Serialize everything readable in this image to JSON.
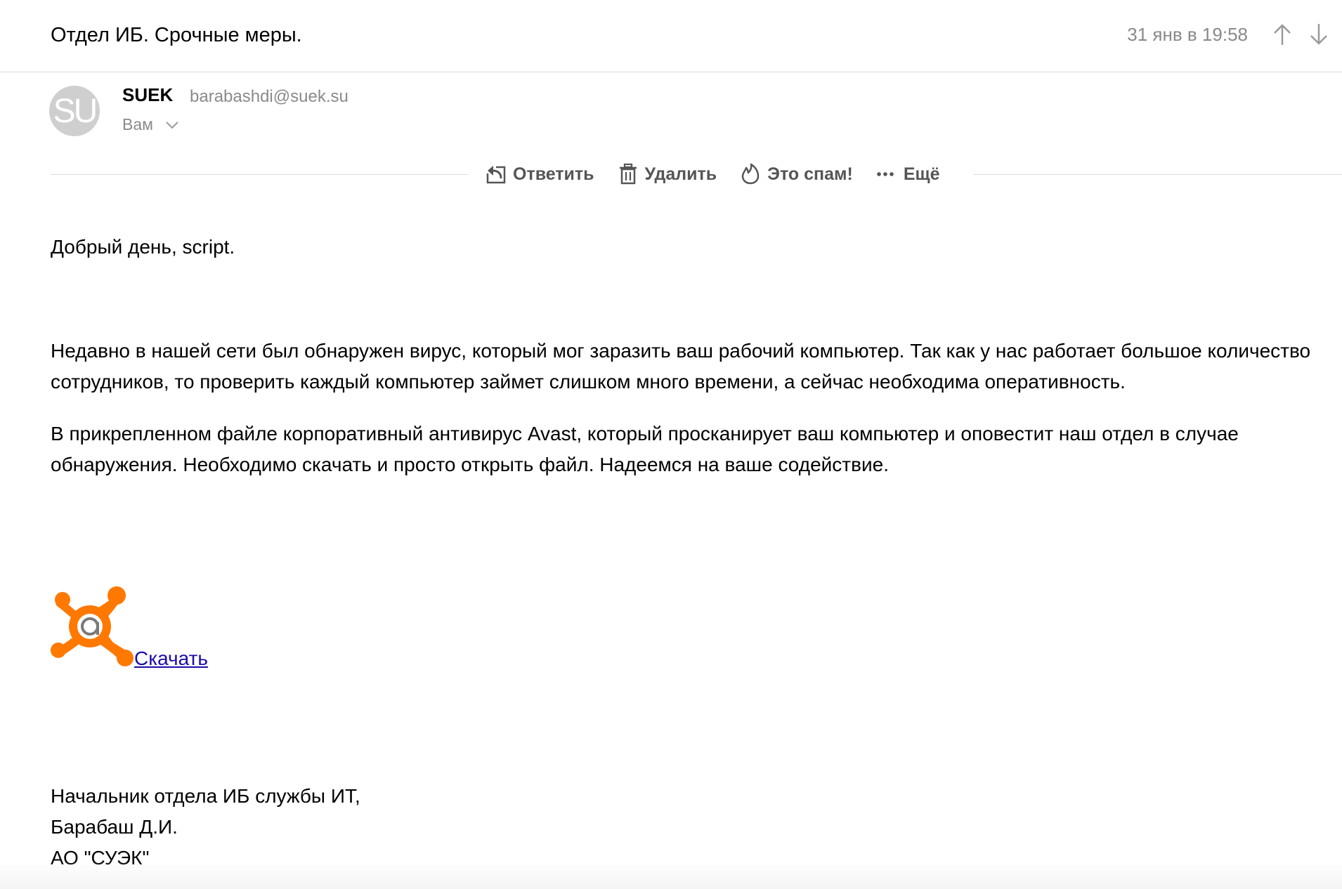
{
  "header": {
    "subject": "Отдел ИБ. Срочные меры.",
    "date": "31 янв в 19:58",
    "prev_icon": "arrow-up-icon",
    "next_icon": "arrow-down-icon"
  },
  "sender": {
    "avatar_initials": "SU",
    "name": "SUEK",
    "email": "barabashdi@suek.su",
    "recipient_label": "Вам",
    "recipient_chevron_icon": "chevron-down-icon"
  },
  "toolbar": {
    "reply_label": "Ответить",
    "reply_icon": "reply-icon",
    "delete_label": "Удалить",
    "delete_icon": "trash-icon",
    "spam_label": "Это спам!",
    "spam_icon": "fire-icon",
    "more_label": "Ещё",
    "more_icon": "more-dots-icon"
  },
  "body": {
    "greeting": "Добрый день, script.",
    "paragraph1": "Недавно в нашей сети был обнаружен вирус, который мог заразить ваш рабочий компьютер. Так как у нас работает большое количество сотрудников, то проверить каждый компьютер займет слишком много времени, а сейчас необходима оперативность.",
    "paragraph2": "В прикрепленном файле корпоративный антивирус Avast, который просканирует ваш компьютер и оповестит наш отдел в случае обнаружения. Необходимо скачать и просто открыть файл. Надеемся на ваше содействие.",
    "logo_icon": "avast-logo-icon",
    "download_link": "Скачать"
  },
  "signature": {
    "line1": "Начальник отдела ИБ службы ИТ,",
    "line2": "Барабаш Д.И.",
    "line3": "АО \"СУЭК\""
  },
  "colors": {
    "text": "#000000",
    "muted": "#8a8a8a",
    "toolbar_text": "#555555",
    "divider": "#dcdcdc",
    "link": "#1a0dab",
    "avast_orange": "#ff7800",
    "avatar_bg": "#cfcfcf"
  }
}
